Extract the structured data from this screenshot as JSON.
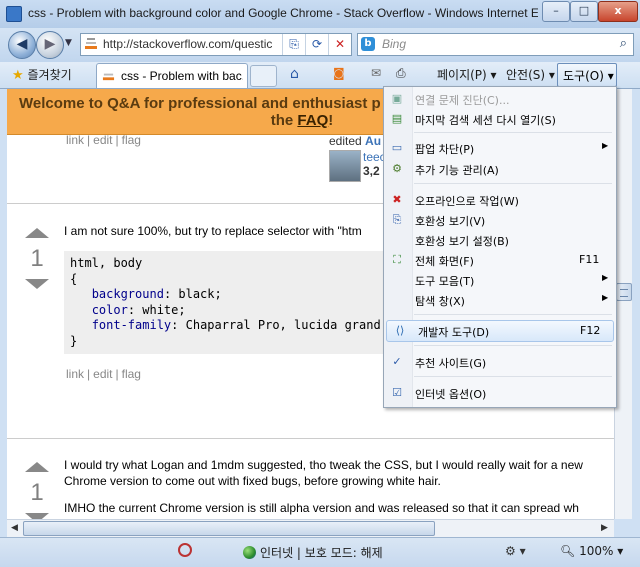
{
  "window": {
    "title": "css - Problem with background color and Google Chrome - Stack Overflow - Windows Internet Expl...",
    "controls": [
      "–",
      "□",
      "x"
    ]
  },
  "nav": {
    "address": "http://stackoverflow.com/questic",
    "search_placeholder": "Bing"
  },
  "tabs": {
    "favorites_label": "즐겨찾기",
    "active_tab": "css - Problem with bac...",
    "page_menu": "페이지(P) ▾",
    "safety_menu": "안전(S) ▾",
    "tools_menu": "도구(O) ▾"
  },
  "banner": {
    "line1": "Welcome to Q&A for professional and enthusiast p",
    "line2_prefix": "the ",
    "line2_link": "FAQ",
    "line2_suffix": "!"
  },
  "post1": {
    "links": [
      "link",
      "edit",
      "flag"
    ],
    "edited_label": "edited",
    "edited_date": "Au",
    "username": "teec",
    "rep": "3,2"
  },
  "answer1": {
    "votes": "1",
    "text": "I am not sure 100%, but try to replace selector with \"htm",
    "code_lines": [
      {
        "prop": "",
        "text": "html, body"
      },
      {
        "prop": "",
        "text": "{"
      },
      {
        "prop": "background",
        "text": ": black;"
      },
      {
        "prop": "color",
        "text": ": white;"
      },
      {
        "prop": "font-family",
        "text": ": Chaparral Pro, lucida grand"
      },
      {
        "prop": "",
        "text": "}"
      }
    ],
    "links": [
      "link",
      "edit",
      "flag"
    ]
  },
  "answer2": {
    "votes": "1",
    "line1": "I would try what Logan and 1mdm suggested, tho tweak the CSS, but I would really wait for a new",
    "line2": "Chrome version to come out with fixed bugs, before growing white hair.",
    "line3": "IMHO the current Chrome version is still alpha version and was released so that it can spread wh"
  },
  "status": {
    "zone": "인터넷 | 보호 모드: 해제",
    "zoom": "100%"
  },
  "tools_menu": {
    "items": [
      {
        "label": "연결 문제 진단(C)...",
        "shortcut": "",
        "submenu": false,
        "disabled": true
      },
      {
        "label": "마지막 검색 세션 다시 열기(S)",
        "shortcut": "",
        "submenu": false,
        "disabled": false
      },
      {
        "label": "팝업 차단(P)",
        "shortcut": "",
        "submenu": true,
        "disabled": false
      },
      {
        "label": "추가 기능 관리(A)",
        "shortcut": "",
        "submenu": false,
        "disabled": false
      },
      {
        "label": "오프라인으로 작업(W)",
        "shortcut": "",
        "submenu": false,
        "disabled": false
      },
      {
        "label": "호환성 보기(V)",
        "shortcut": "",
        "submenu": false,
        "disabled": false
      },
      {
        "label": "호환성 보기 설정(B)",
        "shortcut": "",
        "submenu": false,
        "disabled": false
      },
      {
        "label": "전체 화면(F)",
        "shortcut": "F11",
        "submenu": false,
        "disabled": false
      },
      {
        "label": "도구 모음(T)",
        "shortcut": "",
        "submenu": true,
        "disabled": false
      },
      {
        "label": "탐색 창(X)",
        "shortcut": "",
        "submenu": true,
        "disabled": false
      },
      {
        "label": "개발자 도구(D)",
        "shortcut": "F12",
        "submenu": false,
        "disabled": false,
        "highlighted": true
      },
      {
        "label": "추천 사이트(G)",
        "shortcut": "",
        "submenu": false,
        "disabled": false,
        "checked": true
      },
      {
        "label": "인터넷 옵션(O)",
        "shortcut": "",
        "submenu": false,
        "disabled": false
      }
    ]
  },
  "colors": {
    "banner": "#f6a94b",
    "menu_highlight": "#d8e8fa",
    "link": "#3b72b7"
  }
}
